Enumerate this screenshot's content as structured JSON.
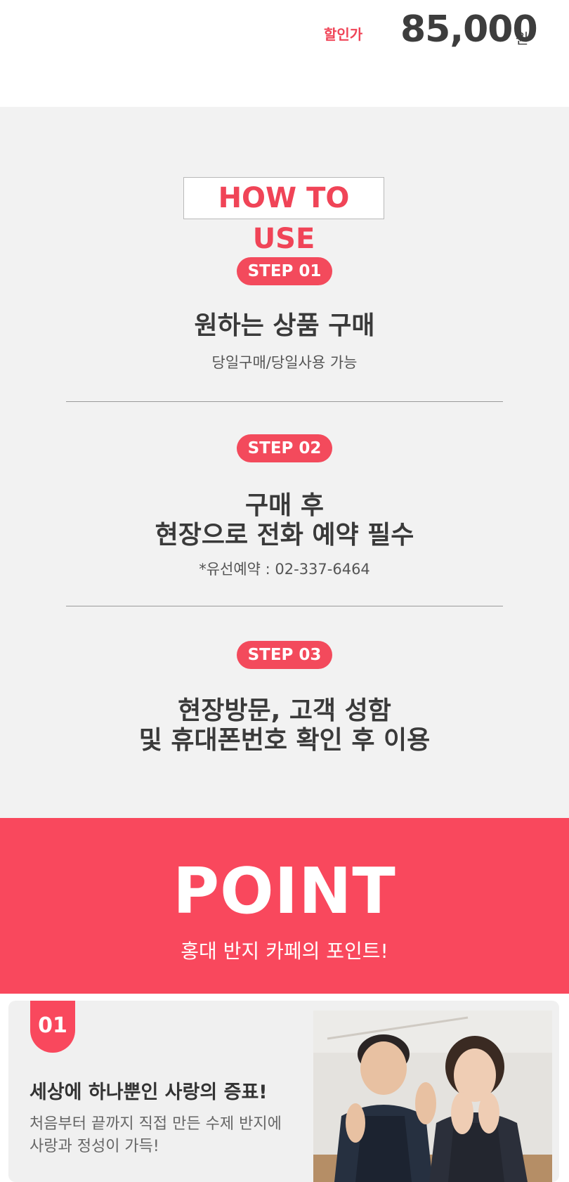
{
  "price": {
    "label": "할인가",
    "value": "85,000",
    "unit": "원"
  },
  "how_to_use": {
    "title": "HOW TO USE",
    "steps": [
      {
        "pill": "STEP 01",
        "title_lines": [
          "원하는 상품 구매"
        ],
        "sub": "당일구매/당일사용 가능"
      },
      {
        "pill": "STEP 02",
        "title_lines": [
          "구매 후",
          "현장으로 전화 예약 필수"
        ],
        "sub": "*유선예약 : 02-337-6464"
      },
      {
        "pill": "STEP 03",
        "title_lines": [
          "현장방문, 고객 성함",
          "및 휴대폰번호 확인 후 이용"
        ],
        "sub": ""
      }
    ]
  },
  "point": {
    "title": "POINT",
    "subtitle": "홍대 반지 카페의 포인트!"
  },
  "point_card": {
    "number": "01",
    "title": "세상에 하나뿐인 사랑의 증표!",
    "desc_lines": [
      "처음부터 끝까지 직접 만든 수제 반지에",
      "사랑과 정성이 가득!"
    ]
  },
  "colors": {
    "accent": "#f9485d",
    "pill": "#f34a5c",
    "label_red": "#f04457",
    "section_bg": "#f2f2f2"
  }
}
